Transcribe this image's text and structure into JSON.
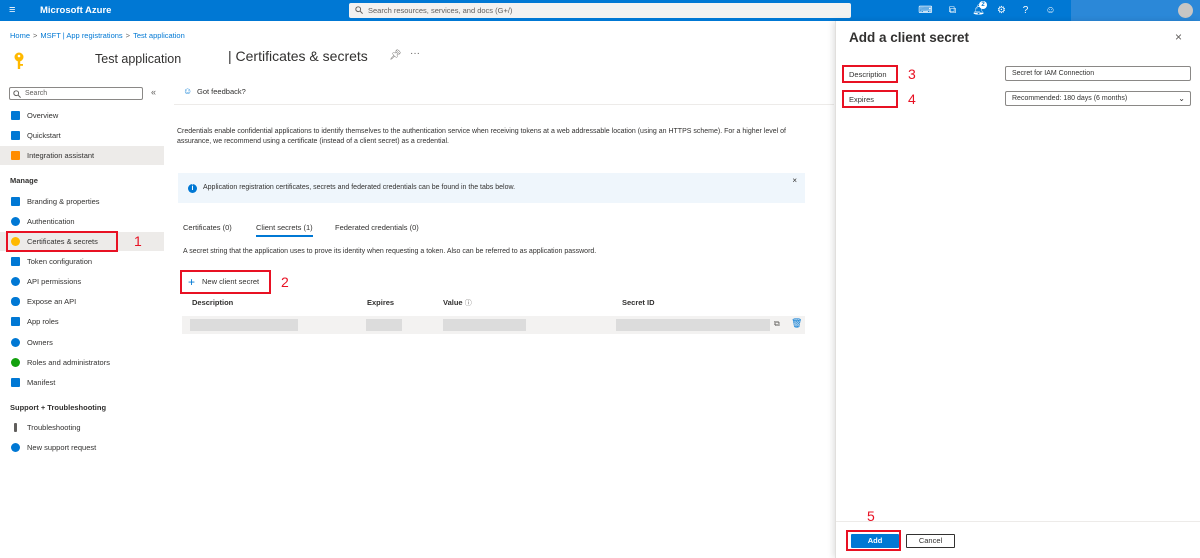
{
  "topbar": {
    "brand": "Microsoft Azure",
    "search_placeholder": "Search resources, services, and docs (G+/)",
    "notification_count": "2",
    "icons": [
      "cloud-shell-icon",
      "directory-filter-icon",
      "notifications-icon",
      "settings-icon",
      "help-icon",
      "feedback-icon"
    ]
  },
  "breadcrumb": {
    "home": "Home",
    "sep": ">",
    "app_registrations": "MSFT | App registrations",
    "current": "Test application"
  },
  "header": {
    "app_name": "Test application",
    "page_title": "| Certificates & secrets",
    "more": "···"
  },
  "sidebar": {
    "search_placeholder": "Search",
    "collapse": "«",
    "items": [
      {
        "label": "Overview",
        "icon": "overview-icon",
        "color": "#0078d4"
      },
      {
        "label": "Quickstart",
        "icon": "quickstart-icon",
        "color": "#0078d4"
      },
      {
        "label": "Integration assistant",
        "icon": "rocket-icon",
        "color": "#ff8c00"
      }
    ],
    "manage_heading": "Manage",
    "manage_items": [
      {
        "label": "Branding & properties",
        "icon": "branding-icon",
        "color": "#0078d4"
      },
      {
        "label": "Authentication",
        "icon": "authentication-icon",
        "color": "#0078d4"
      },
      {
        "label": "Certificates & secrets",
        "icon": "key-icon",
        "color": "#ffb900"
      },
      {
        "label": "Token configuration",
        "icon": "token-icon",
        "color": "#0078d4"
      },
      {
        "label": "API permissions",
        "icon": "api-permissions-icon",
        "color": "#0078d4"
      },
      {
        "label": "Expose an API",
        "icon": "cloud-icon",
        "color": "#0078d4"
      },
      {
        "label": "App roles",
        "icon": "app-roles-icon",
        "color": "#0078d4"
      },
      {
        "label": "Owners",
        "icon": "owners-icon",
        "color": "#0078d4"
      },
      {
        "label": "Roles and administrators",
        "icon": "roles-icon",
        "color": "#13a10e"
      },
      {
        "label": "Manifest",
        "icon": "manifest-icon",
        "color": "#0078d4"
      }
    ],
    "support_heading": "Support + Troubleshooting",
    "support_items": [
      {
        "label": "Troubleshooting",
        "icon": "wrench-icon",
        "color": "#323130"
      },
      {
        "label": "New support request",
        "icon": "support-request-icon",
        "color": "#0078d4"
      }
    ]
  },
  "main": {
    "feedback": "Got feedback?",
    "description": "Credentials enable confidential applications to identify themselves to the authentication service when receiving tokens at a web addressable location (using an HTTPS scheme). For a higher level of assurance, we recommend using a certificate (instead of a client secret) as a credential.",
    "info": "Application registration certificates, secrets and federated credentials can be found in the tabs below.",
    "tabs": [
      {
        "label": "Certificates (0)"
      },
      {
        "label": "Client secrets (1)"
      },
      {
        "label": "Federated credentials (0)"
      }
    ],
    "active_tab": "Client secrets (1)",
    "tab_description": "A secret string that the application uses to prove its identity when requesting a token. Also can be referred to as application password.",
    "new_secret_button": "New client secret",
    "table": {
      "columns": [
        "Description",
        "Expires",
        "Value",
        "Secret ID"
      ],
      "value_info": "ⓘ"
    }
  },
  "panel": {
    "title": "Add a client secret",
    "close": "×",
    "description_label": "Description",
    "description_value": "Secret for IAM Connection",
    "expires_label": "Expires",
    "expires_value": "Recommended: 180 days (6 months)",
    "add_button": "Add",
    "cancel_button": "Cancel"
  },
  "annotations": {
    "labels": [
      "1",
      "2",
      "3",
      "4",
      "5"
    ],
    "color": "#e81123"
  }
}
